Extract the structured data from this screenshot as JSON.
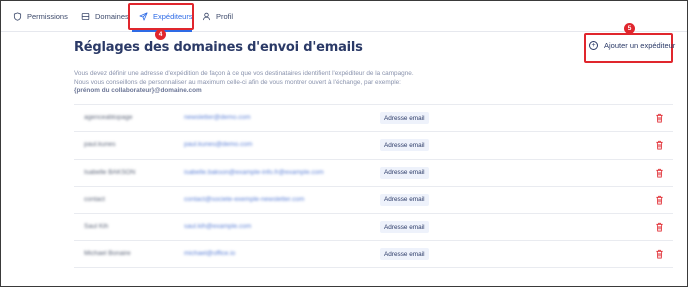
{
  "nav": {
    "tabs": [
      {
        "label": "Permissions",
        "icon": "shield-icon"
      },
      {
        "label": "Domaines",
        "icon": "server-icon"
      },
      {
        "label": "Expéditeurs",
        "icon": "send-icon",
        "active": true
      },
      {
        "label": "Profil",
        "icon": "user-icon"
      }
    ]
  },
  "annotations": {
    "step_tab": "4",
    "step_button": "5"
  },
  "page": {
    "title": "Réglages des domaines d'envoi d'emails",
    "add_button": "Ajouter un expéditeur",
    "description_line1": "Vous devez définir une adresse d'expédition de façon à ce que vos destinataires identifient l'expéditeur de la campagne.",
    "description_line2": "Nous vous conseillons de personnaliser au maximum celle-ci afin de vous montrer ouvert à l'échange, par exemple:",
    "description_example": "{prénom du collaborateur}@domaine.com"
  },
  "senders": [
    {
      "name": "agenceabtopage",
      "email": "newsletter@demo.com",
      "type": "Adresse email"
    },
    {
      "name": "paul.kunes",
      "email": "paul.kunes@demo.com",
      "type": "Adresse email"
    },
    {
      "name": "Isabelle BAKSON",
      "email": "isabelle.bakson@example-info.fr@example.com",
      "type": "Adresse email"
    },
    {
      "name": "contact",
      "email": "contact@societe-exemple-newsletter.com",
      "type": "Adresse email"
    },
    {
      "name": "Saul Kih",
      "email": "saul.kih@example.com",
      "type": "Adresse email"
    },
    {
      "name": "Michael Bonaire",
      "email": "michael@office.io",
      "type": "Adresse email"
    }
  ],
  "colors": {
    "accent": "#2e6be6",
    "highlight": "#e0262d",
    "title": "#2b3a67",
    "delete": "#e0262d"
  }
}
